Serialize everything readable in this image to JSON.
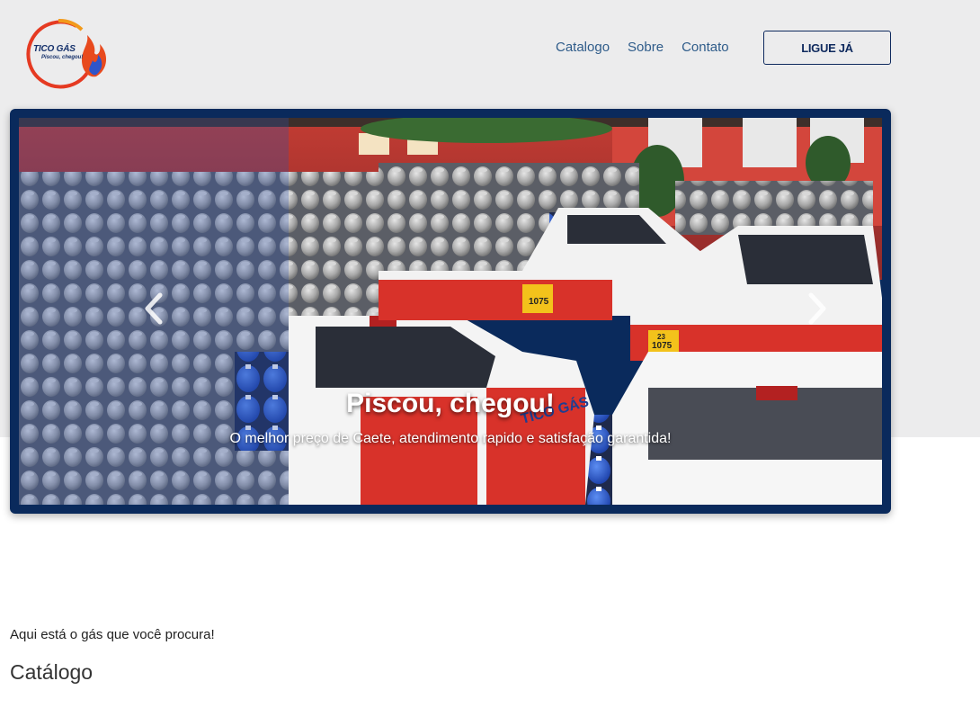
{
  "brand": {
    "name": "TICO GÁS",
    "tagline": "Piscou, chegou!",
    "colors": {
      "navy": "#0f2a5e",
      "red": "#e03a24",
      "orange": "#f29a1b",
      "flame_blue": "#2f55c9"
    }
  },
  "nav": {
    "items": [
      {
        "label": "Catalogo"
      },
      {
        "label": "Sobre"
      },
      {
        "label": "Contato"
      }
    ],
    "cta_label": "LIGUE JÁ"
  },
  "carousel": {
    "title": "Piscou, chegou!",
    "subtitle": "O melhor preço de Caete, atendimento rapido e satisfação garantida!",
    "prev_icon": "chevron-left-icon",
    "next_icon": "chevron-right-icon",
    "photo": {
      "truck_labels": [
        "1075",
        "23",
        "TICO GÁS"
      ]
    }
  },
  "catalog": {
    "intro": "Aqui está o gás que você procura!",
    "title": "Catálogo"
  }
}
